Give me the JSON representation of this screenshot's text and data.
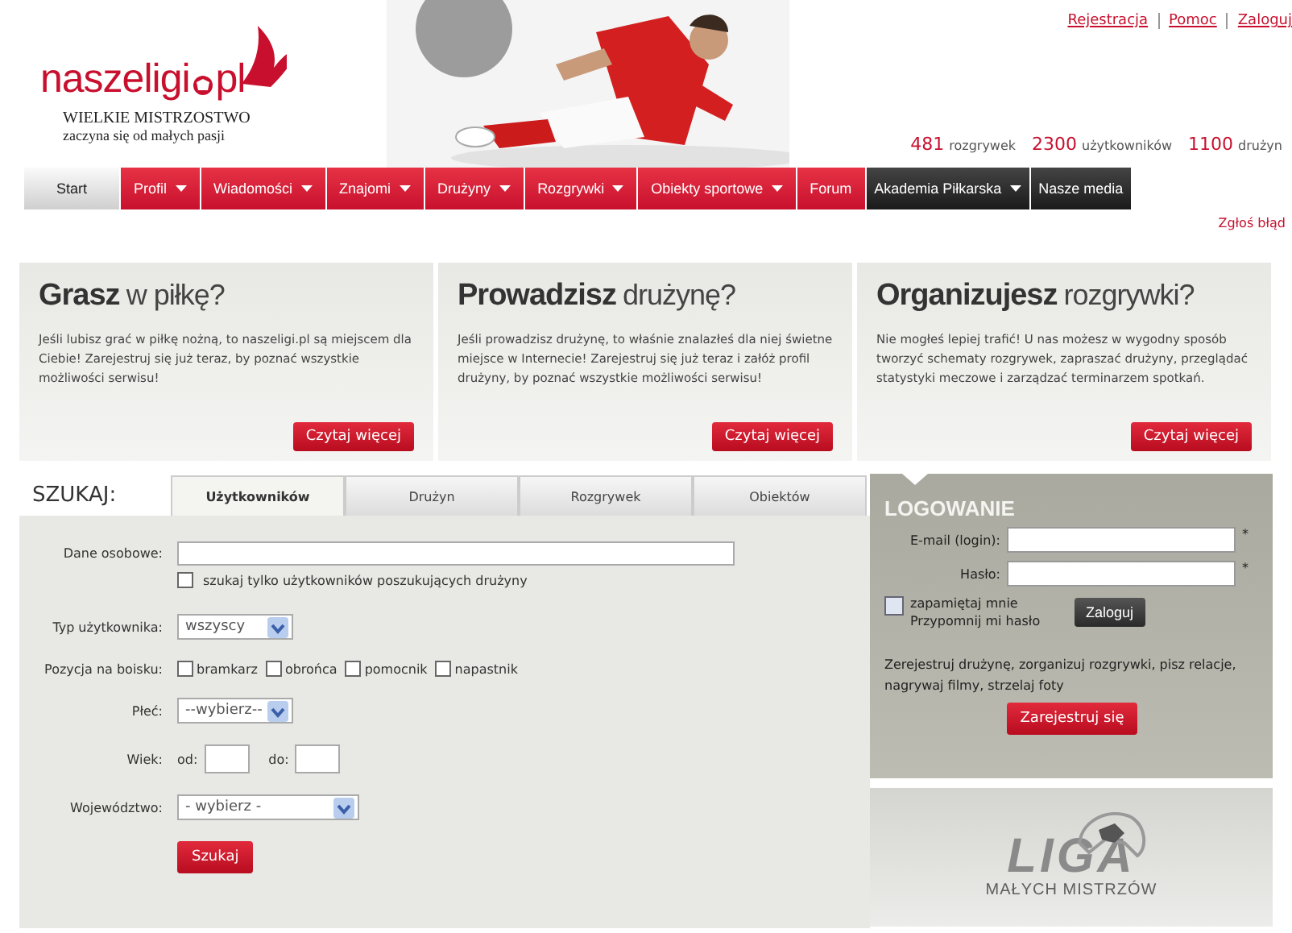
{
  "header": {
    "logo_left": "naszeligi",
    "logo_right": "pl",
    "slogan_line1": "WIELKIE MISTRZOSTWO",
    "slogan_line2": "zaczyna się od małych pasji",
    "top_links": [
      "Rejestracja",
      "Pomoc",
      "Zaloguj"
    ],
    "stats": [
      {
        "number": "481",
        "label": "rozgrywek"
      },
      {
        "number": "2300",
        "label": "użytkowników"
      },
      {
        "number": "1100",
        "label": "drużyn"
      }
    ]
  },
  "nav": [
    {
      "label": "Start",
      "selected": true,
      "dropdown": false,
      "dark": false
    },
    {
      "label": "Profil",
      "selected": false,
      "dropdown": true,
      "dark": false
    },
    {
      "label": "Wiadomości",
      "selected": false,
      "dropdown": true,
      "dark": false
    },
    {
      "label": "Znajomi",
      "selected": false,
      "dropdown": true,
      "dark": false
    },
    {
      "label": "Drużyny",
      "selected": false,
      "dropdown": true,
      "dark": false
    },
    {
      "label": "Rozgrywki",
      "selected": false,
      "dropdown": true,
      "dark": false
    },
    {
      "label": "Obiekty sportowe",
      "selected": false,
      "dropdown": true,
      "dark": false
    },
    {
      "label": "Forum",
      "selected": false,
      "dropdown": false,
      "dark": false
    },
    {
      "label": "Akademia Piłkarska",
      "selected": false,
      "dropdown": true,
      "dark": true
    },
    {
      "label": "Nasze media",
      "selected": false,
      "dropdown": false,
      "dark": true
    }
  ],
  "report_link": "Zgłoś błąd",
  "cards": [
    {
      "title_bold": "Grasz",
      "title_light": "w piłkę?",
      "text": "Jeśli lubisz grać w piłkę nożną, to naszeligi.pl są miejscem dla Ciebie! Zarejestruj się już teraz, by poznać wszystkie możliwości serwisu!",
      "button": "Czytaj więcej"
    },
    {
      "title_bold": "Prowadzisz",
      "title_light": "drużynę?",
      "text": "Jeśli prowadzisz drużynę, to właśnie znalazłeś dla niej świetne miejsce w Internecie! Zarejestruj się już teraz i załóż profil drużyny, by poznać wszystkie możliwości serwisu!",
      "button": "Czytaj więcej"
    },
    {
      "title_bold": "Organizujesz",
      "title_light": "rozgrywki?",
      "text": "Nie mogłeś lepiej trafić! U nas możesz w wygodny sposób tworzyć schematy rozgrywek, zapraszać drużyny, przeglądać statystyki meczowe i zarządzać terminarzem spotkań.",
      "button": "Czytaj więcej"
    }
  ],
  "search": {
    "title": "SZUKAJ:",
    "tabs": [
      {
        "label": "Użytkowników",
        "selected": true
      },
      {
        "label": "Drużyn",
        "selected": false
      },
      {
        "label": "Rozgrywek",
        "selected": false
      },
      {
        "label": "Obiektów",
        "selected": false
      }
    ],
    "rows": [
      {
        "kind": "text",
        "label": "Dane osobowe:",
        "value": ""
      },
      {
        "kind": "checkbox",
        "label": "szukaj tylko użytkowników poszukujących drużyny",
        "checked": false
      },
      {
        "kind": "select",
        "label": "Typ użytkownika:",
        "value": "wszyscy",
        "wide": false
      },
      {
        "kind": "checks",
        "label": "Pozycja na boisku:",
        "options": [
          {
            "label": "bramkarz",
            "checked": false
          },
          {
            "label": "obrońca",
            "checked": false
          },
          {
            "label": "pomocnik",
            "checked": false
          },
          {
            "label": "napastnik",
            "checked": false
          }
        ]
      },
      {
        "kind": "select",
        "label": "Płeć:",
        "value": "--wybierz--",
        "wide": false
      },
      {
        "kind": "range",
        "label": "Wiek:",
        "from_label": "od:",
        "to_label": "do:"
      },
      {
        "kind": "select",
        "label": "Województwo:",
        "value": "- wybierz -",
        "wide": true
      },
      {
        "kind": "button",
        "label": "Szukaj"
      }
    ]
  },
  "login": {
    "title": "LOGOWANIE",
    "email_label": "E-mail (login):",
    "password_label": "Hasło:",
    "required_mark": "*",
    "remember_label": "zapamiętaj mnie",
    "remember_checked": false,
    "forgot_link": "Przypomnij mi hasło",
    "login_button": "Zaloguj",
    "promo": "Zerejestruj drużynę, zorganizuj rozgrywki, pisz relacje, nagrywaj filmy, strzelaj foty",
    "register_button": "Zarejestruj się"
  },
  "banner": {
    "title": "LIGA",
    "subtitle": "MAŁYCH MISTRZÓW"
  }
}
